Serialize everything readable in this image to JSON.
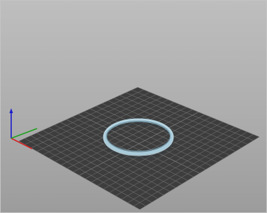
{
  "viewport": {
    "kind": "3d-scene-viewport",
    "background_top": "#bebebe",
    "background_bottom": "#9c9c9c"
  },
  "ground_grid": {
    "fill_color": "#3d3d3d",
    "line_color": "#6e6e6e",
    "major_line_color": "#8a8a8a",
    "divisions": 20
  },
  "scene_object": {
    "type": "ring",
    "outer_color": "#a9cbd9",
    "inner_color": "#6f93a4"
  },
  "axis_gizmo": {
    "x_color": "#d42020",
    "y_color": "#1ea01e",
    "z_color": "#1a1acc"
  }
}
